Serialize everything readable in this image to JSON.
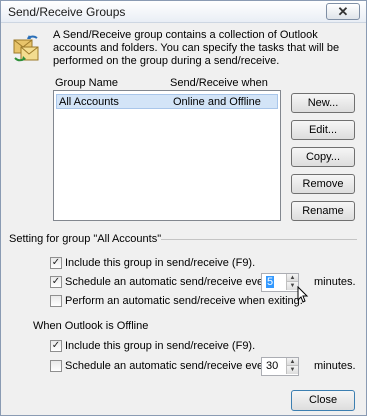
{
  "window": {
    "title": "Send/Receive Groups",
    "close_glyph": "✕"
  },
  "description": "A Send/Receive group contains a collection of Outlook accounts and folders. You can specify the tasks that will be performed on the group during a send/receive.",
  "list": {
    "columns": [
      "Group Name",
      "Send/Receive when"
    ],
    "rows": [
      {
        "name": "All Accounts",
        "when": "Online and Offline",
        "selected": true
      }
    ]
  },
  "buttons": {
    "new": "New...",
    "edit": "Edit...",
    "copy": "Copy...",
    "remove": "Remove",
    "rename": "Rename",
    "close": "Close"
  },
  "settings": {
    "title": "Setting for group \"All Accounts\"",
    "include": {
      "label": "Include this group in send/receive (F9).",
      "checked": true
    },
    "schedule": {
      "label": "Schedule an automatic send/receive every",
      "checked": true,
      "value": "5",
      "unit": "minutes."
    },
    "exit": {
      "label": "Perform an automatic send/receive when exiting.",
      "checked": false
    }
  },
  "offline": {
    "title": "When Outlook is Offline",
    "include": {
      "label": "Include this group in send/receive (F9).",
      "checked": true
    },
    "schedule": {
      "label": "Schedule an automatic send/receive every",
      "checked": false,
      "value": "30",
      "unit": "minutes."
    }
  },
  "icons": {
    "app": "send-receive-icon",
    "check": "checkmark-icon",
    "cursor": "mouse-pointer-icon"
  },
  "colors": {
    "selection": "#d3e4f7",
    "accent": "#3399ff"
  }
}
